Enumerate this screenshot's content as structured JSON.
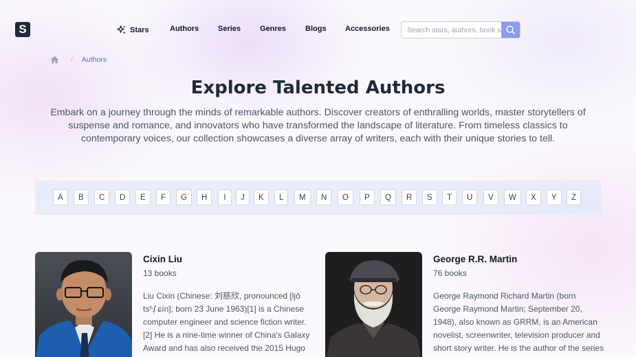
{
  "header": {
    "logo_letter": "S",
    "nav": [
      {
        "label": "Stars",
        "icon": "sparkles-icon"
      },
      {
        "label": "Authors"
      },
      {
        "label": "Series"
      },
      {
        "label": "Genres"
      },
      {
        "label": "Blogs"
      },
      {
        "label": "Accessories"
      }
    ],
    "search": {
      "placeholder": "Search stars, authors, book series",
      "icon": "search-icon"
    }
  },
  "breadcrumb": {
    "home_icon": "home-icon",
    "separator": "/",
    "current": "Authors"
  },
  "page": {
    "title": "Explore Talented Authors",
    "intro": "Embark on a journey through the minds of remarkable authors. Discover creators of enthralling worlds, master storytellers of suspense and romance, and innovators who have transformed the landscape of literature. From timeless classics to contemporary voices, our collection showcases a diverse array of writers, each with their unique stories to tell."
  },
  "alphabet": [
    "A",
    "B",
    "C",
    "D",
    "E",
    "F",
    "G",
    "H",
    "I",
    "J",
    "K",
    "L",
    "M",
    "N",
    "O",
    "P",
    "Q",
    "R",
    "S",
    "T",
    "U",
    "V",
    "W",
    "X",
    "Y",
    "Z"
  ],
  "authors": [
    {
      "name": "Cixin Liu",
      "books": "13 books",
      "bio": "Liu Cixin (Chinese: 刘慈欣, pronounced [ljǒ tsʰɹ̩̌ ɕín]; born 23 June 1963)[1] is a Chinese computer engineer and science fiction writer.[2] He is a nine-time winner of China's Galaxy Award and has also received the 2015 Hugo"
    },
    {
      "name": "George R.R. Martin",
      "books": "76 books",
      "bio": "George Raymond Richard Martin (born George Raymond Martin; September 20, 1948), also known as GRRM, is an American novelist, screenwriter, television producer and short story writer. He is the author of the series of"
    }
  ],
  "colors": {
    "accent": "#4b6bd6",
    "search_button": "#8b9bf0",
    "alpha_bar": "#e0e8fa"
  }
}
